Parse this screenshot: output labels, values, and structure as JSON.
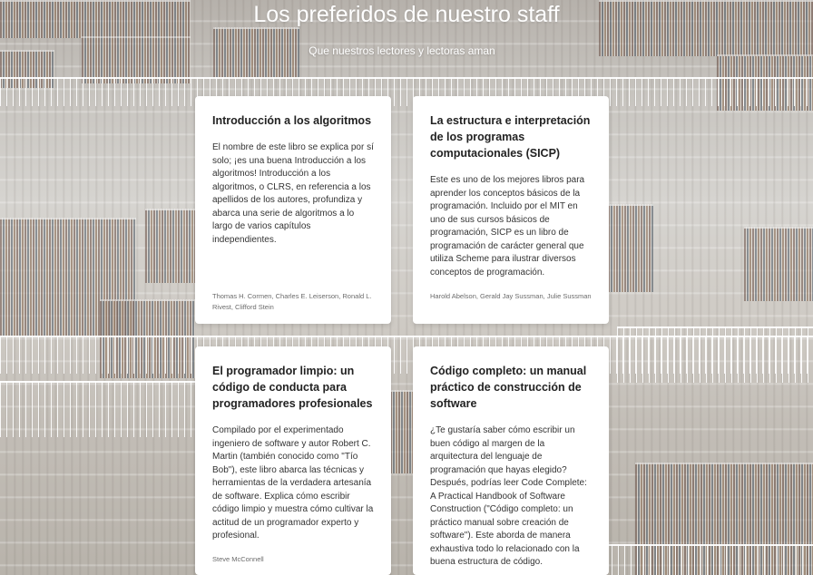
{
  "header": {
    "title": "Los preferidos de nuestro staff",
    "subtitle": "Que nuestros lectores y lectoras aman"
  },
  "books": [
    {
      "title": "Introducción a los algoritmos",
      "description": "El nombre de este libro se explica por sí solo; ¡es una buena Introducción a los algoritmos! Introducción a los algoritmos, o CLRS, en referencia a los apellidos de los autores, profundiza y abarca una serie de algoritmos a lo largo de varios capítulos independientes.",
      "authors": "Thomas H. Cormen, Charles E. Leiserson, Ronald L. Rivest, Clifford Stein"
    },
    {
      "title": "La estructura e interpretación de los programas computacionales (SICP)",
      "description": "Este es uno de los mejores libros para aprender los conceptos básicos de la programación. Incluido por el MIT en uno de sus cursos básicos de programación, SICP es un libro de programación de carácter general que utiliza Scheme para ilustrar diversos conceptos de programación.",
      "authors": "Harold Abelson, Gerald Jay Sussman, Julie Sussman"
    },
    {
      "title": "El programador limpio: un código de conducta para programadores profesionales",
      "description": "Compilado por el experimentado ingeniero de software y autor Robert C. Martin (también conocido como \"Tío Bob\"), este libro abarca las técnicas y herramientas de la verdadera artesanía de software. Explica cómo escribir código limpio y muestra cómo cultivar la actitud de un programador experto y profesional.",
      "authors": "Steve McConnell"
    },
    {
      "title": "Código completo: un manual práctico de construcción de software",
      "description": "¿Te gustaría saber cómo escribir un buen código al margen de la arquitectura del lenguaje de programación que hayas elegido? Después, podrías leer Code Complete: A Practical Handbook of Software Construction (\"Código completo: un práctico manual sobre creación de software\"). Este aborda de manera exhaustiva todo lo relacionado con la buena estructura de código.",
      "authors": ""
    }
  ]
}
